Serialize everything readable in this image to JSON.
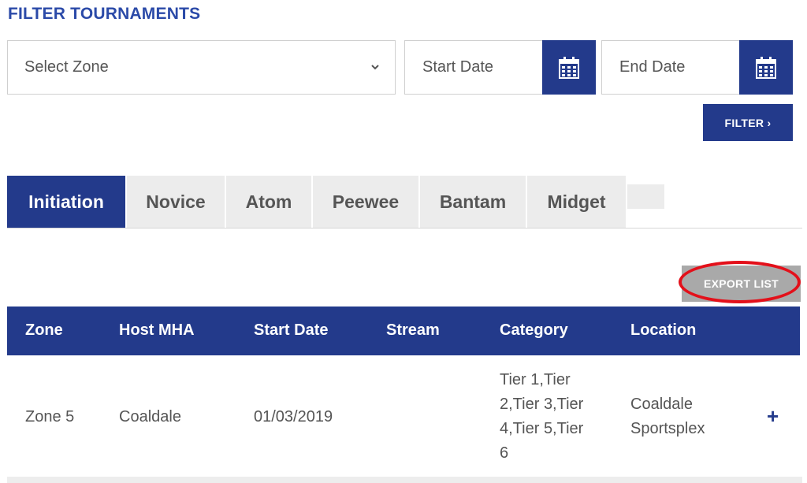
{
  "heading": "FILTER TOURNAMENTS",
  "zone_select": {
    "value": "Select Zone",
    "icon": "chevron-down-icon"
  },
  "start_date": {
    "placeholder": "Start Date",
    "icon": "calendar-icon"
  },
  "end_date": {
    "placeholder": "End Date",
    "icon": "calendar-icon"
  },
  "filter_button": "FILTER ›",
  "tabs": [
    "Initiation",
    "Novice",
    "Atom",
    "Peewee",
    "Bantam",
    "Midget"
  ],
  "active_tab": "Initiation",
  "export_button": "EXPORT LIST",
  "table": {
    "headers": [
      "Zone",
      "Host MHA",
      "Start Date",
      "Stream",
      "Category",
      "Location"
    ],
    "rows": [
      {
        "zone": "Zone 5",
        "host": "Coaldale",
        "start_date": "01/03/2019",
        "stream": "",
        "category_lines": [
          "Tier 1,Tier",
          "2,Tier 3,Tier",
          "4,Tier 5,Tier",
          "6"
        ],
        "location_lines": [
          "Coaldale",
          "Sportsplex"
        ],
        "expand": "+"
      }
    ]
  },
  "colors": {
    "primary": "#233a8b",
    "heading": "#2b4aa8",
    "tab_inactive": "#ececec",
    "export_bg": "#a9a9a9",
    "highlight": "#e3101a"
  }
}
